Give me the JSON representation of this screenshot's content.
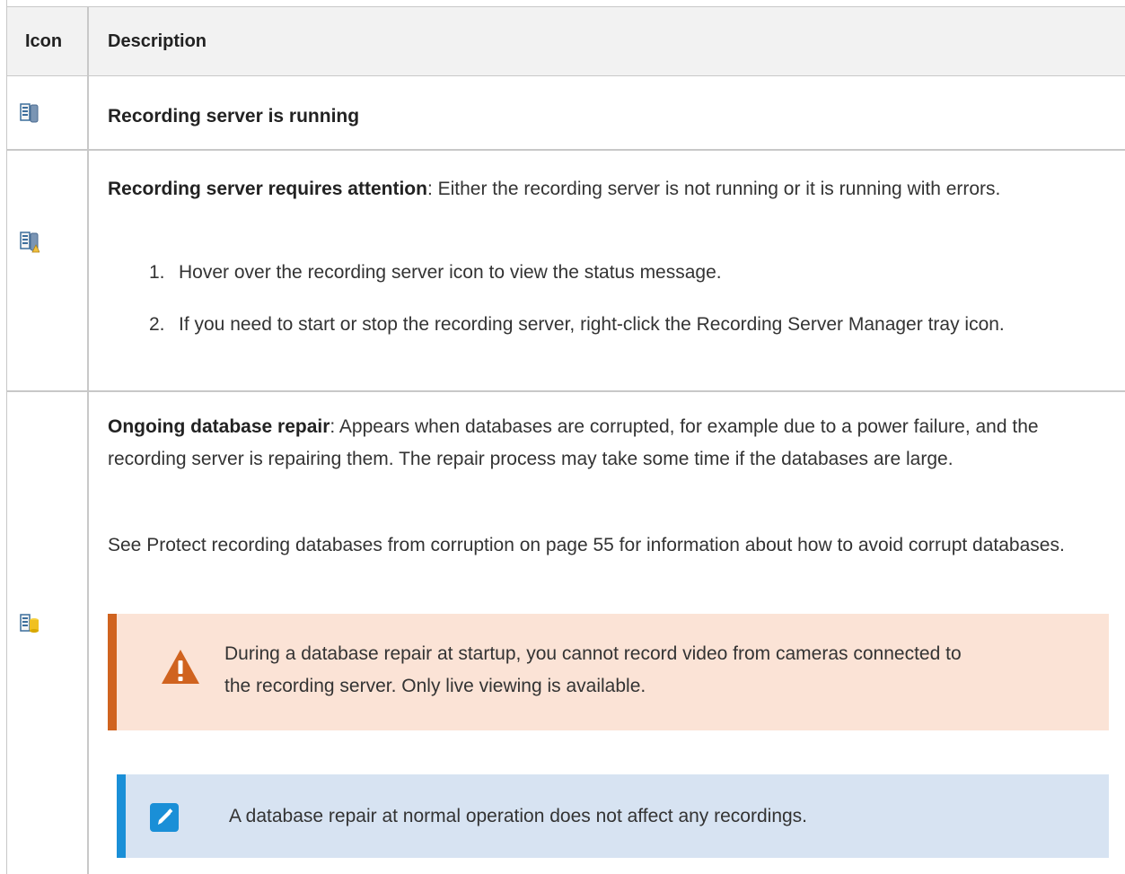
{
  "header": {
    "icon": "Icon",
    "description": "Description"
  },
  "rows": [
    {
      "icon": "server-running-icon",
      "title": "Recording server is running",
      "text": ""
    },
    {
      "icon": "server-attention-icon",
      "title": "Recording server requires attention",
      "text": ": Either the recording server is not running or it is running with errors.",
      "steps": [
        {
          "num": "1.",
          "text": "Hover over the recording server icon to view the status message."
        },
        {
          "num": "2.",
          "text": "If you need to start or stop the recording server, right-click the Recording Server Manager tray icon."
        }
      ]
    },
    {
      "icon": "server-database-repair-icon",
      "title": "Ongoing database repair",
      "text": ": Appears when databases are corrupted, for example due to a power failure, and the recording server is repairing them. The repair process may take some time if the databases are large.",
      "para": "See Protect recording databases from corruption on page 55 for information about how to avoid corrupt databases.",
      "warning": "During a database repair at startup, you cannot record video from cameras connected to the recording server. Only live viewing is available.",
      "note": "A database repair at normal operation does not affect any recordings."
    }
  ],
  "colors": {
    "warning_accent": "#d0631f",
    "warning_bg": "#fbe3d6",
    "note_accent": "#1a8fd7",
    "note_bg": "#d7e3f2"
  }
}
